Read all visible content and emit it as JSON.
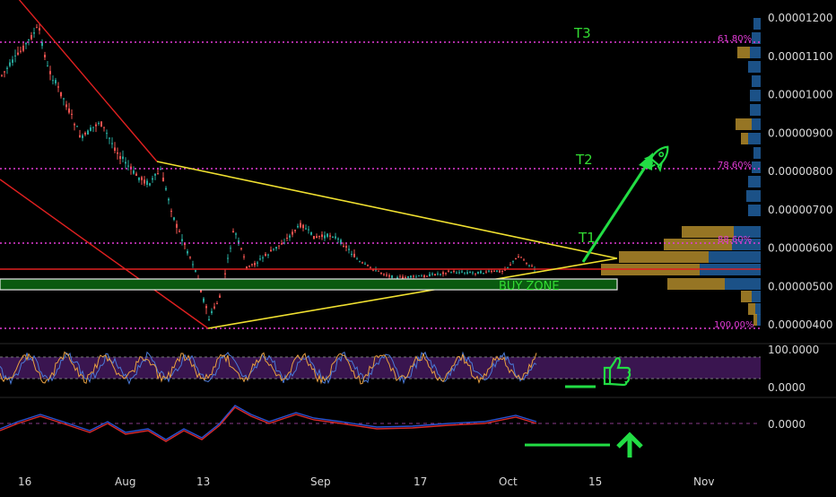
{
  "chart_data": {
    "type": "candlestick",
    "price_axis": {
      "labels": [
        "0.00001200",
        "0.00001100",
        "0.00001000",
        "0.00000900",
        "0.00000800",
        "0.00000700",
        "0.00000600",
        "0.00000500",
        "0.00000400"
      ],
      "values": [
        1.2e-05,
        1.1e-05,
        1e-05,
        9e-06,
        8e-06,
        7e-06,
        6e-06,
        5e-06,
        4e-06
      ],
      "range": [
        3.9e-06,
        1.22e-05
      ]
    },
    "oscillator_axis": {
      "labels": [
        "100.0000",
        "0.0000"
      ]
    },
    "macd_axis": {
      "labels": [
        "0.0000"
      ]
    },
    "time_axis": {
      "labels": [
        "16",
        "Aug",
        "13",
        "Sep",
        "17",
        "Oct",
        "15",
        "Nov"
      ]
    },
    "fib_levels": [
      {
        "label": "61.80%",
        "value": 1.14e-05
      },
      {
        "label": "78.60%",
        "value": 8e-06
      },
      {
        "label": "88.60%",
        "value": 6.1e-06
      },
      {
        "label": "100.00%",
        "value": 4e-06
      }
    ],
    "targets": [
      "T3",
      "T2",
      "T1"
    ],
    "zones": [
      {
        "label": "BUY ZONE",
        "low": 4.9e-06,
        "high": 5.1e-06
      }
    ],
    "support_line": 5.4e-06,
    "volume_profile": true,
    "colors": {
      "background": "#000000",
      "fib": "#e23bd6",
      "target": "#33dd33",
      "trendline_red": "#e02020",
      "triangle": "#f0e030",
      "buy_zone": "#0a5a10",
      "arrow": "#22dd44",
      "up_candle": "#26a69a",
      "down_candle": "#ef5350",
      "oscillator_band": "#3a1550",
      "vp_blue": "#1e5a96",
      "vp_gold": "#b08a2a"
    },
    "icons": [
      "rocket-icon",
      "thumbs-up-icon",
      "up-arrow-icon"
    ]
  }
}
